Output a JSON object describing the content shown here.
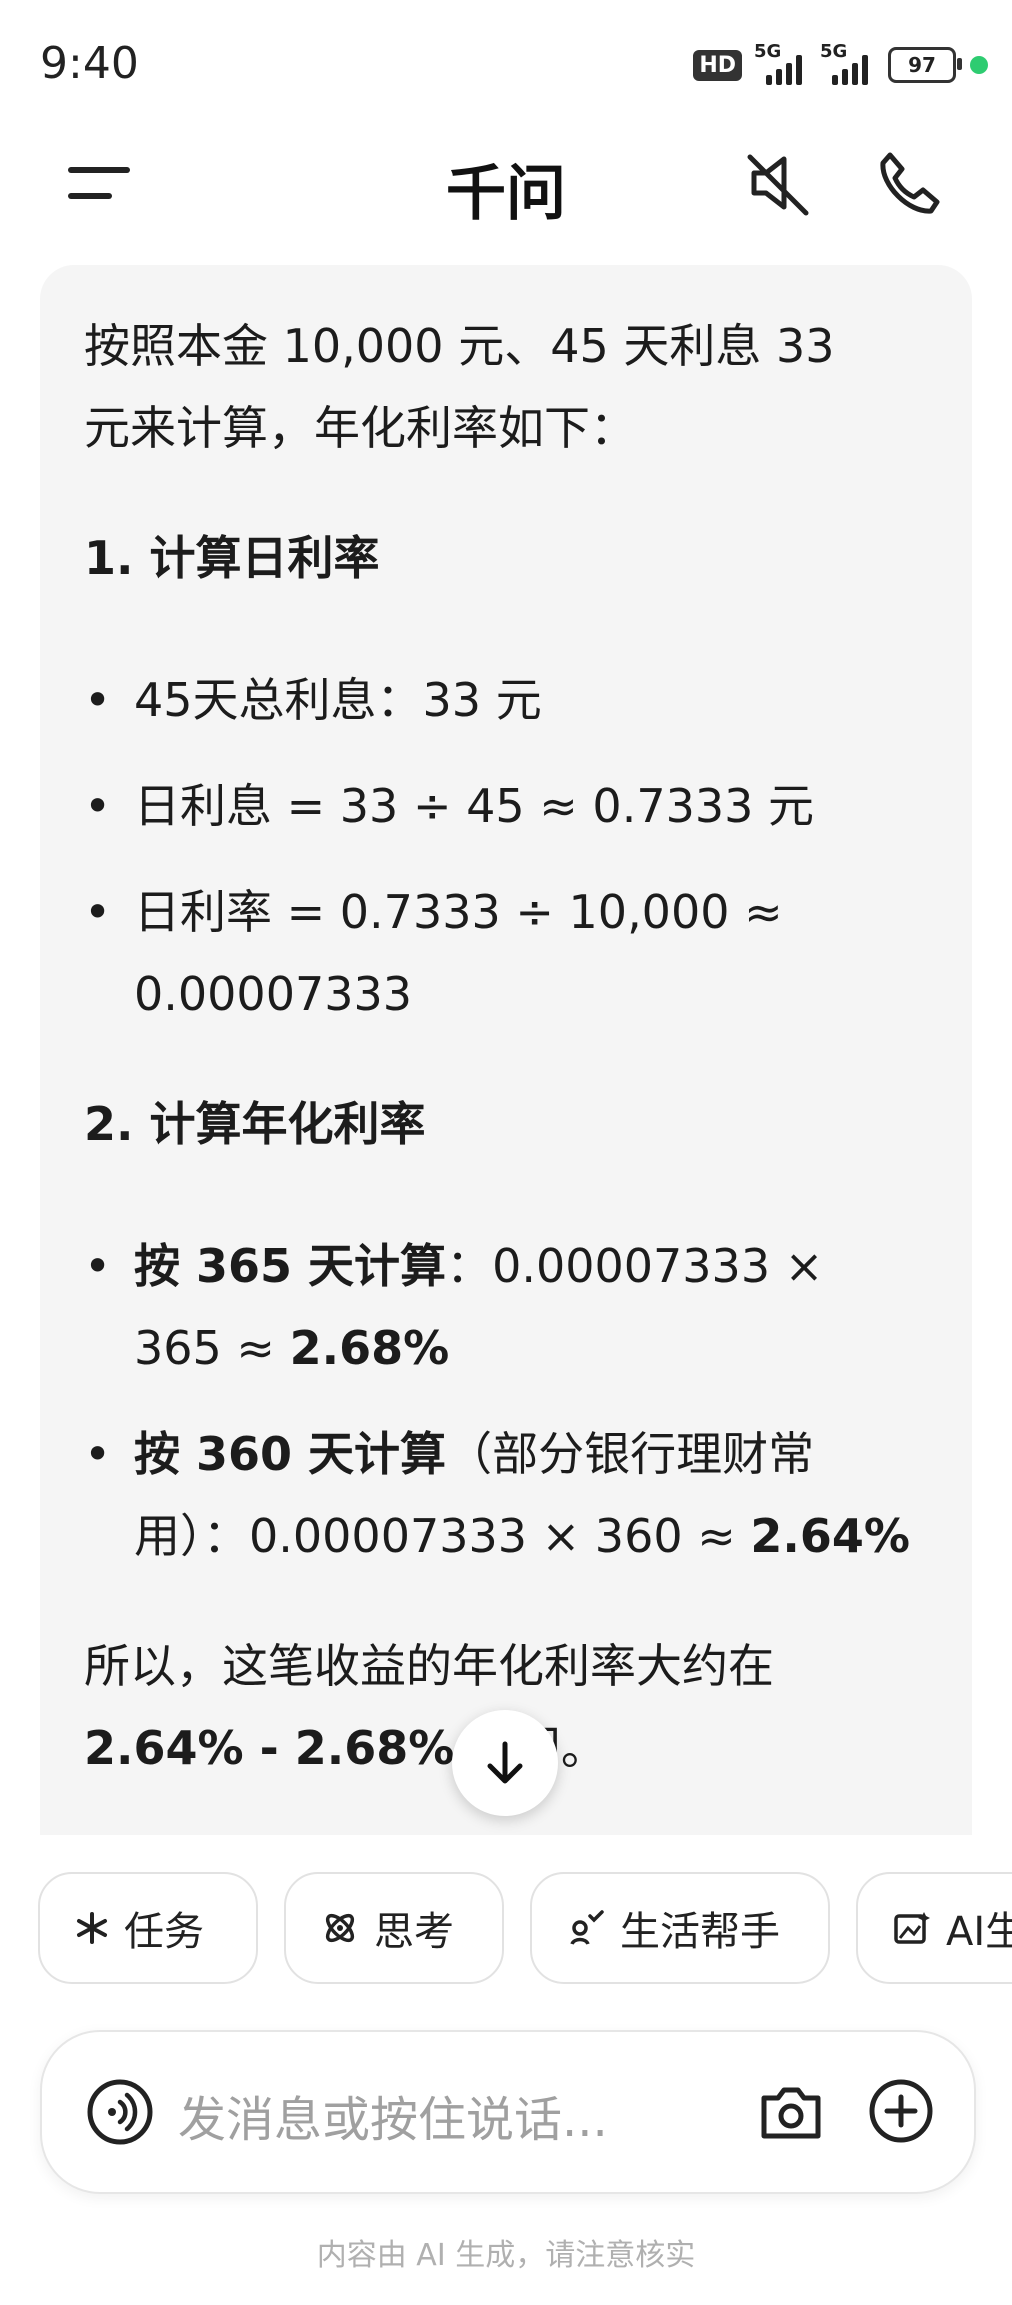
{
  "status_bar": {
    "time": "9:40",
    "hd_badge": "HD",
    "network_1": "5G",
    "network_2": "5G",
    "battery": "97"
  },
  "header": {
    "title": "千问",
    "menu_icon": "menu-icon",
    "mute_icon": "speaker-mute-icon",
    "phone_icon": "phone-icon"
  },
  "message": {
    "intro_1": "按照本金 10,000 元、45 天利息 33",
    "intro_2": "元来计算，年化利率如下：",
    "step1_heading": "1. 计算日利率",
    "step1_items": [
      {
        "line1": "45天总利息：33 元"
      },
      {
        "line1": "日利息 = 33 ÷ 45 ≈ 0.7333 元"
      },
      {
        "line1": "日利率 = 0.7333 ÷ 10,000 ≈",
        "line2": "0.00007333"
      }
    ],
    "step2_heading": "2. 计算年化利率",
    "step2_items": [
      {
        "bold": "按 365 天计算",
        "rest1": "：0.00007333 ×",
        "rest2": "365 ≈ ",
        "result": "2.68%"
      },
      {
        "bold": "按 360 天计算",
        "rest1": "（部分银行理财常",
        "rest2": "用）：0.00007333 × 360 ≈ ",
        "result": "2.64%"
      }
    ],
    "conclusion_1": "所以，这笔收益的年化利率大约在",
    "conclusion_range": "2.64% - 2.68%",
    "conclusion_tail": " 之间。"
  },
  "chips": [
    {
      "label": "任务",
      "icon": "asterisk-icon"
    },
    {
      "label": "思考",
      "icon": "atom-icon"
    },
    {
      "label": "生活帮手",
      "icon": "assistant-icon"
    },
    {
      "label": "AI生",
      "icon": "image-edit-icon"
    }
  ],
  "input": {
    "placeholder": "发消息或按住说话..."
  },
  "footer": {
    "disclaimer": "内容由 AI 生成，请注意核实"
  },
  "colors": {
    "card_bg": "#f5f5f5",
    "accent_green": "#2ecc71",
    "text": "#1c1c1c"
  }
}
